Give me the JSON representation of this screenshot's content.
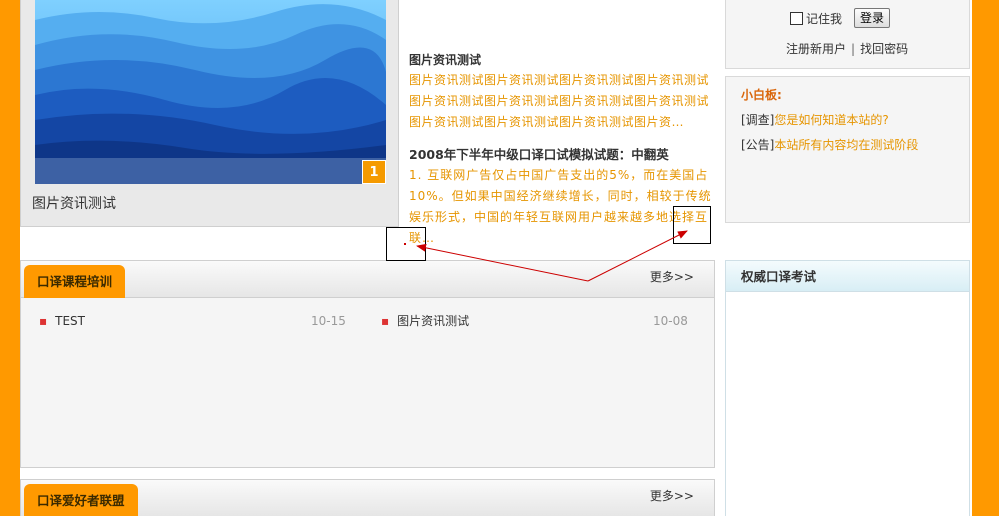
{
  "image_slider": {
    "page_number": "1",
    "caption": "图片资讯测试"
  },
  "news": {
    "item1_title": "图片资讯测试",
    "item1_summary": "图片资讯测试图片资讯测试图片资讯测试图片资讯测试图片资讯测试图片资讯测试图片资讯测试图片资讯测试图片资讯测试图片资讯测试图片资讯测试图片资…",
    "item2_title": "2008年下半年中级口译口试模拟试题：中翻英",
    "item2_summary": "1. 互联网广告仅占中国广告支出的5%，而在美国占10%。但如果中国经济继续增长，同时，相较于传统娱乐形式，中国的年轻互联网用户越来越多地选择互联…"
  },
  "login": {
    "remember_label": "记住我",
    "login_button": "登录",
    "register_link": "注册新用户",
    "separator": "|",
    "forgot_link": "找回密码"
  },
  "notice_board": {
    "title": "小白板:",
    "items": [
      {
        "tag": "[调查]",
        "text": "您是如何知道本站的?"
      },
      {
        "tag": "[公告]",
        "text": "本站所有内容均在测试阶段"
      }
    ]
  },
  "section_training": {
    "title": "口译课程培训",
    "more": "更多>>",
    "items": [
      {
        "title": "TEST",
        "date": "10-15"
      },
      {
        "title": "图片资讯测试",
        "date": "10-08"
      }
    ]
  },
  "section_union": {
    "title": "口译爱好者联盟",
    "more": "更多>>"
  },
  "section_exam": {
    "title": "权威口译考试"
  },
  "colors": {
    "side_bar": "#FF9900",
    "tab": "#FF9900",
    "link_orange": "#E69500",
    "annotation_arrow": "#CC0000"
  }
}
